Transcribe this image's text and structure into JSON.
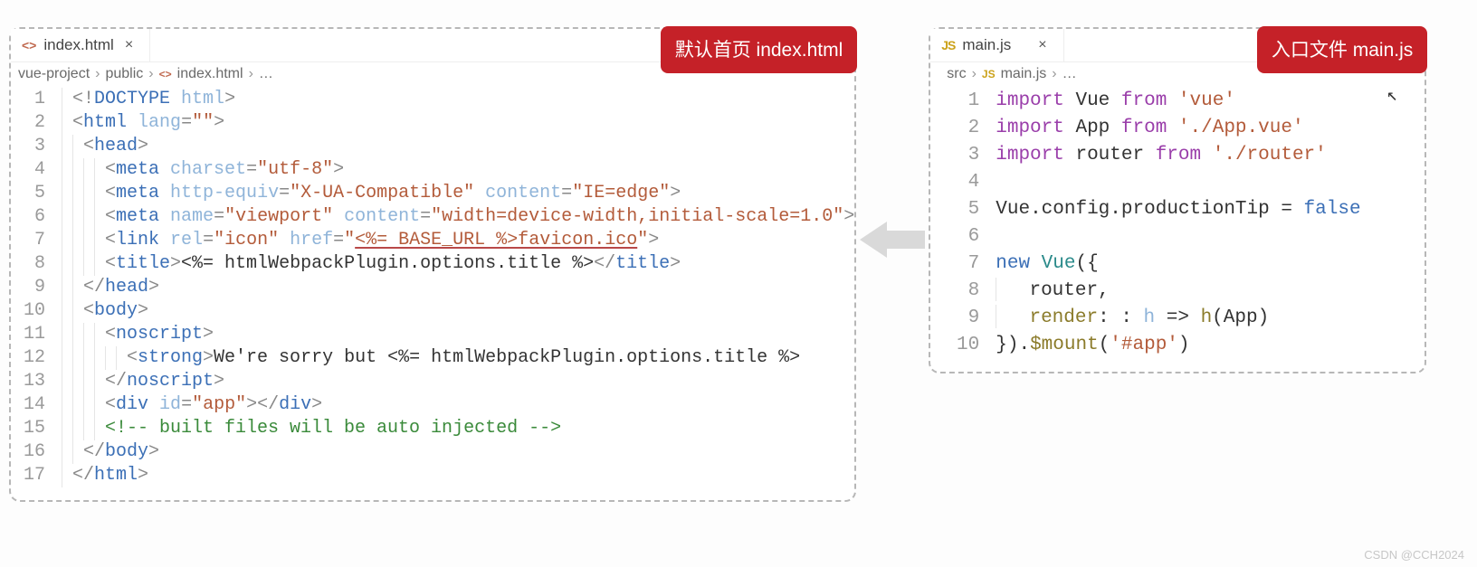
{
  "left": {
    "badge": "默认首页 index.html",
    "tab": {
      "icon": "<>",
      "name": "index.html",
      "close": "×"
    },
    "breadcrumbs": [
      "vue-project",
      "public",
      "index.html",
      "…"
    ],
    "lines": [
      "1",
      "2",
      "3",
      "4",
      "5",
      "6",
      "7",
      "8",
      "9",
      "10",
      "11",
      "12",
      "13",
      "14",
      "15",
      "16",
      "17"
    ],
    "code": {
      "l1_doctype_open": "<!",
      "l1_doctype_kw": "DOCTYPE",
      "l1_doctype_sp": " ",
      "l1_doctype_html": "html",
      "l1_doctype_close": ">",
      "l2_open": "<",
      "l2_tag": "html",
      "l2_sp": " ",
      "l2_attr": "lang",
      "l2_eq": "=",
      "l2_val": "\"\"",
      "l2_close": ">",
      "l3_open": "<",
      "l3_tag": "head",
      "l3_close": ">",
      "l4_open": "<",
      "l4_tag": "meta",
      "l4_sp": " ",
      "l4_attr": "charset",
      "l4_eq": "=",
      "l4_val": "\"utf-8\"",
      "l4_close": ">",
      "l5_open": "<",
      "l5_tag": "meta",
      "l5_sp": " ",
      "l5_attr1": "http-equiv",
      "l5_eq1": "=",
      "l5_val1": "\"X-UA-Compatible\"",
      "l5_sp2": " ",
      "l5_attr2": "content",
      "l5_eq2": "=",
      "l5_val2": "\"IE=edge\"",
      "l5_close": ">",
      "l6_open": "<",
      "l6_tag": "meta",
      "l6_sp": " ",
      "l6_attr1": "name",
      "l6_eq1": "=",
      "l6_val1": "\"viewport\"",
      "l6_sp2": " ",
      "l6_attr2": "content",
      "l6_eq2": "=",
      "l6_val2": "\"width=device-width,initial-scale=1.0\"",
      "l6_close": ">",
      "l7_open": "<",
      "l7_tag": "link",
      "l7_sp": " ",
      "l7_attr1": "rel",
      "l7_eq1": "=",
      "l7_val1": "\"icon\"",
      "l7_sp2": " ",
      "l7_attr2": "href",
      "l7_eq2": "=",
      "l7_q": "\"",
      "l7_uline": "<%= BASE_URL %>favicon.ico",
      "l7_q2": "\"",
      "l7_close": ">",
      "l8_open": "<",
      "l8_tag": "title",
      "l8_close": ">",
      "l8_text": "<%= htmlWebpackPlugin.options.title %>",
      "l8_copen": "</",
      "l8_ctag": "title",
      "l8_cclose": ">",
      "l9_open": "</",
      "l9_tag": "head",
      "l9_close": ">",
      "l10_open": "<",
      "l10_tag": "body",
      "l10_close": ">",
      "l11_open": "<",
      "l11_tag": "noscript",
      "l11_close": ">",
      "l12_open": "<",
      "l12_tag": "strong",
      "l12_close": ">",
      "l12_txt": "We're sorry but <%= htmlWebpackPlugin.options.title %>",
      "l13_open": "</",
      "l13_tag": "noscript",
      "l13_close": ">",
      "l14_open": "<",
      "l14_tag": "div",
      "l14_sp": " ",
      "l14_attr": "id",
      "l14_eq": "=",
      "l14_val": "\"app\"",
      "l14_close": ">",
      "l14_copen": "</",
      "l14_ctag": "div",
      "l14_cclose": ">",
      "l15_cm": "<!-- built files will be auto injected -->",
      "l16_open": "</",
      "l16_tag": "body",
      "l16_close": ">",
      "l17_open": "</",
      "l17_tag": "html",
      "l17_close": ">"
    }
  },
  "right": {
    "badge": "入口文件 main.js",
    "tab": {
      "icon": "JS",
      "name": "main.js",
      "close": "×"
    },
    "breadcrumbs": [
      "src",
      "main.js",
      "…"
    ],
    "lines": [
      "1",
      "2",
      "3",
      "4",
      "5",
      "6",
      "7",
      "8",
      "9",
      "10"
    ],
    "code": {
      "l1_kw": "import",
      "l1_id": " Vue ",
      "l1_from": "from",
      "l1_sp": " ",
      "l1_str": "'vue'",
      "l2_kw": "import",
      "l2_id": " App ",
      "l2_from": "from",
      "l2_sp": " ",
      "l2_str": "'./App.vue'",
      "l3_kw": "import",
      "l3_id": " router ",
      "l3_from": "from",
      "l3_sp": " ",
      "l3_str": "'./router'",
      "l5_a": "Vue",
      ".": ".",
      "l5_b": "config",
      "l5_c": ".",
      "l5_d": "productionTip",
      "l5_e": " = ",
      "l5_f": "false",
      "l7_kw": "new",
      "l7_sp": " ",
      "l7_cls": "Vue",
      "l7_p": "({",
      "l8": "router,",
      "l9_a": "render",
      ":": ": ",
      "l9_b": "h",
      "l9_c": " => ",
      "l9_d": "h",
      "l9_e": "(App)",
      "l10_a": "}).",
      "l10_b": "$mount",
      "l10_c": "(",
      "l10_d": "'#app'",
      "l10_e": ")"
    }
  },
  "watermark": "CSDN @CCH2024"
}
